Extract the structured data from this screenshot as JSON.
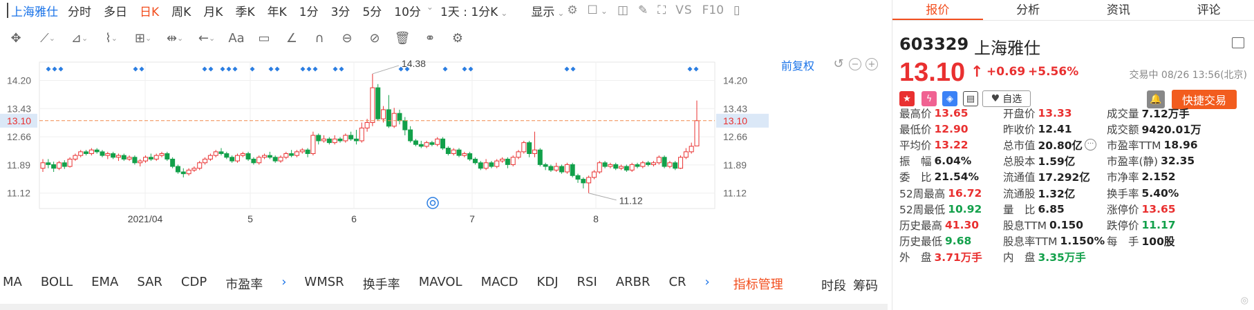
{
  "window": {
    "stock_name": "上海雅仕"
  },
  "period_tabs": [
    {
      "label": "分时",
      "active": false
    },
    {
      "label": "多日",
      "active": false
    },
    {
      "label": "日K",
      "active": true
    },
    {
      "label": "周K",
      "active": false
    },
    {
      "label": "月K",
      "active": false
    },
    {
      "label": "季K",
      "active": false
    },
    {
      "label": "年K",
      "active": false
    },
    {
      "label": "1分",
      "active": false
    },
    {
      "label": "3分",
      "active": false
    },
    {
      "label": "5分",
      "active": false
    },
    {
      "label": "10分",
      "active": false
    }
  ],
  "period_extra": {
    "interval_select": "1天 : 1分K",
    "display_menu": "显示",
    "vs_label": "VS",
    "f10_label": "F10"
  },
  "draw_tools": [
    "move-icon",
    "line-icon",
    "ray-icon",
    "wave-icon",
    "fib-icon",
    "range-icon",
    "arrow-icon",
    "text-icon",
    "comment-icon",
    "angle-icon",
    "arc-icon",
    "lock-icon",
    "hide-icon",
    "trash-icon",
    "overlay-icon",
    "settings-icon"
  ],
  "chart": {
    "fuquan_label": "前复权",
    "y_ticks": [
      "14.20",
      "13.43",
      "12.66",
      "11.89",
      "11.12"
    ],
    "current_price": "13.10",
    "high_label": "14.38",
    "low_label": "11.12",
    "x_ticks": [
      "2021/04",
      "5",
      "6",
      "7",
      "8"
    ]
  },
  "chart_data": {
    "type": "candlestick",
    "ylim": [
      10.7,
      14.7
    ],
    "current_price": 13.1,
    "high": 14.38,
    "low": 11.12,
    "candles": [
      [
        11.8,
        11.95,
        11.7,
        12.05
      ],
      [
        11.95,
        11.9,
        11.8,
        12.05
      ],
      [
        11.9,
        11.8,
        11.7,
        11.98
      ],
      [
        11.8,
        11.95,
        11.75,
        12.0
      ],
      [
        11.95,
        11.85,
        11.78,
        12.02
      ],
      [
        11.85,
        12.05,
        11.82,
        12.1
      ],
      [
        12.05,
        12.15,
        12.0,
        12.2
      ],
      [
        12.15,
        12.25,
        12.1,
        12.3
      ],
      [
        12.25,
        12.2,
        12.15,
        12.3
      ],
      [
        12.2,
        12.3,
        12.15,
        12.35
      ],
      [
        12.3,
        12.25,
        12.2,
        12.35
      ],
      [
        12.25,
        12.15,
        12.1,
        12.3
      ],
      [
        12.15,
        12.2,
        12.05,
        12.25
      ],
      [
        12.2,
        12.1,
        12.05,
        12.25
      ],
      [
        12.1,
        12.15,
        12.0,
        12.2
      ],
      [
        12.15,
        12.05,
        12.0,
        12.2
      ],
      [
        12.05,
        12.1,
        12.0,
        12.15
      ],
      [
        12.1,
        11.95,
        11.9,
        12.15
      ],
      [
        11.95,
        12.0,
        11.85,
        12.05
      ],
      [
        12.0,
        12.1,
        11.95,
        12.15
      ],
      [
        12.1,
        12.05,
        12.0,
        12.2
      ],
      [
        12.05,
        12.15,
        12.0,
        12.2
      ],
      [
        12.15,
        12.2,
        12.1,
        12.25
      ],
      [
        12.2,
        12.05,
        12.0,
        12.25
      ],
      [
        12.05,
        11.85,
        11.8,
        12.1
      ],
      [
        11.85,
        11.7,
        11.65,
        11.9
      ],
      [
        11.7,
        11.65,
        11.55,
        11.8
      ],
      [
        11.65,
        11.75,
        11.6,
        11.8
      ],
      [
        11.75,
        11.8,
        11.7,
        11.85
      ],
      [
        11.8,
        11.95,
        11.75,
        12.0
      ],
      [
        11.95,
        12.05,
        11.9,
        12.1
      ],
      [
        12.05,
        12.15,
        12.0,
        12.2
      ],
      [
        12.15,
        12.25,
        12.1,
        12.3
      ],
      [
        12.25,
        12.2,
        12.15,
        12.35
      ],
      [
        12.2,
        12.1,
        12.05,
        12.25
      ],
      [
        12.1,
        12.0,
        11.95,
        12.15
      ],
      [
        12.0,
        12.15,
        11.95,
        12.2
      ],
      [
        12.15,
        12.2,
        12.1,
        12.25
      ],
      [
        12.2,
        12.05,
        12.0,
        12.25
      ],
      [
        12.05,
        11.95,
        11.9,
        12.1
      ],
      [
        11.95,
        12.1,
        11.9,
        12.15
      ],
      [
        12.1,
        12.15,
        12.05,
        12.2
      ],
      [
        12.15,
        12.1,
        12.05,
        12.25
      ],
      [
        12.1,
        12.0,
        11.95,
        12.15
      ],
      [
        12.0,
        12.1,
        11.95,
        12.15
      ],
      [
        12.1,
        12.2,
        12.05,
        12.25
      ],
      [
        12.2,
        12.15,
        12.1,
        12.3
      ],
      [
        12.15,
        12.25,
        12.1,
        12.3
      ],
      [
        12.25,
        12.3,
        12.2,
        12.35
      ],
      [
        12.3,
        12.2,
        12.1,
        12.35
      ],
      [
        12.2,
        12.7,
        12.15,
        12.8
      ],
      [
        12.7,
        12.55,
        12.45,
        12.75
      ],
      [
        12.55,
        12.6,
        12.5,
        12.7
      ],
      [
        12.6,
        12.5,
        12.45,
        12.65
      ],
      [
        12.5,
        12.6,
        12.45,
        12.7
      ],
      [
        12.6,
        12.55,
        12.5,
        12.65
      ],
      [
        12.55,
        12.7,
        12.5,
        12.75
      ],
      [
        12.7,
        12.6,
        12.55,
        12.8
      ],
      [
        12.6,
        12.55,
        12.45,
        12.85
      ],
      [
        12.55,
        12.9,
        12.5,
        13.05
      ],
      [
        12.9,
        13.05,
        12.8,
        13.15
      ],
      [
        13.05,
        14.0,
        12.95,
        14.38
      ],
      [
        14.0,
        13.15,
        13.1,
        14.1
      ],
      [
        13.15,
        13.4,
        13.05,
        13.5
      ],
      [
        13.4,
        12.95,
        12.9,
        13.8
      ],
      [
        12.95,
        13.3,
        12.9,
        13.45
      ],
      [
        13.3,
        13.1,
        13.0,
        13.4
      ],
      [
        13.1,
        12.85,
        12.7,
        13.2
      ],
      [
        12.85,
        12.55,
        12.5,
        12.95
      ],
      [
        12.55,
        12.45,
        12.4,
        12.6
      ],
      [
        12.45,
        12.4,
        12.35,
        12.55
      ],
      [
        12.4,
        12.5,
        12.35,
        12.55
      ],
      [
        12.5,
        12.45,
        12.4,
        12.55
      ],
      [
        12.45,
        12.6,
        12.4,
        12.65
      ],
      [
        12.6,
        12.35,
        12.3,
        12.65
      ],
      [
        12.35,
        12.2,
        12.15,
        12.4
      ],
      [
        12.2,
        12.3,
        12.15,
        12.35
      ],
      [
        12.3,
        12.15,
        12.1,
        12.35
      ],
      [
        12.15,
        12.2,
        12.1,
        12.25
      ],
      [
        12.2,
        12.05,
        12.0,
        12.25
      ],
      [
        12.05,
        11.95,
        11.9,
        12.1
      ],
      [
        11.95,
        11.8,
        11.75,
        12.0
      ],
      [
        11.8,
        11.95,
        11.75,
        12.05
      ],
      [
        11.95,
        11.85,
        11.8,
        12.0
      ],
      [
        11.85,
        12.0,
        11.8,
        12.05
      ],
      [
        12.0,
        12.05,
        11.95,
        12.1
      ],
      [
        12.05,
        11.9,
        11.8,
        12.1
      ],
      [
        11.9,
        12.1,
        11.85,
        12.15
      ],
      [
        12.1,
        12.25,
        12.05,
        12.3
      ],
      [
        12.25,
        12.5,
        12.2,
        12.55
      ],
      [
        12.5,
        12.2,
        12.1,
        12.55
      ],
      [
        12.2,
        12.3,
        12.1,
        12.8
      ],
      [
        12.3,
        11.9,
        11.85,
        12.35
      ],
      [
        11.9,
        11.85,
        11.75,
        11.95
      ],
      [
        11.85,
        11.75,
        11.7,
        11.9
      ],
      [
        11.75,
        11.85,
        11.7,
        11.95
      ],
      [
        11.85,
        11.7,
        11.65,
        11.9
      ],
      [
        11.7,
        11.9,
        11.65,
        11.95
      ],
      [
        11.9,
        11.6,
        11.55,
        11.95
      ],
      [
        11.6,
        11.5,
        11.4,
        11.65
      ],
      [
        11.5,
        11.4,
        11.25,
        11.55
      ],
      [
        11.4,
        11.55,
        11.12,
        11.6
      ],
      [
        11.55,
        11.7,
        11.5,
        11.75
      ],
      [
        11.7,
        11.95,
        11.65,
        12.0
      ],
      [
        11.95,
        11.85,
        11.8,
        12.0
      ],
      [
        11.85,
        11.9,
        11.8,
        11.95
      ],
      [
        11.9,
        11.8,
        11.75,
        11.95
      ],
      [
        11.8,
        11.85,
        11.75,
        11.9
      ],
      [
        11.85,
        11.75,
        11.7,
        11.9
      ],
      [
        11.75,
        11.9,
        11.7,
        11.95
      ],
      [
        11.9,
        11.85,
        11.8,
        11.95
      ],
      [
        11.85,
        11.95,
        11.8,
        12.0
      ],
      [
        11.95,
        11.9,
        11.85,
        12.0
      ],
      [
        11.9,
        11.95,
        11.85,
        12.0
      ],
      [
        11.95,
        12.1,
        11.9,
        12.15
      ],
      [
        12.1,
        11.85,
        11.8,
        12.15
      ],
      [
        11.85,
        11.95,
        11.8,
        12.0
      ],
      [
        11.95,
        11.8,
        11.75,
        12.0
      ],
      [
        11.8,
        12.1,
        11.78,
        12.15
      ],
      [
        12.1,
        12.25,
        12.05,
        12.35
      ],
      [
        12.25,
        12.4,
        12.2,
        12.5
      ],
      [
        12.41,
        13.1,
        12.9,
        13.65
      ]
    ]
  },
  "marker_groups": [
    [
      70,
      3
    ],
    [
      196,
      2
    ],
    [
      296,
      2
    ],
    [
      322,
      3
    ],
    [
      365,
      1
    ],
    [
      392,
      2
    ],
    [
      438,
      3
    ],
    [
      485,
      2
    ],
    [
      580,
      2
    ],
    [
      644,
      1
    ],
    [
      672,
      2
    ],
    [
      820,
      2
    ],
    [
      998,
      2
    ]
  ],
  "x_tick_positions": [
    210,
    362,
    512,
    683,
    862
  ],
  "indicators": [
    "MA",
    "BOLL",
    "EMA",
    "SAR",
    "CDP",
    "市盈率",
    "›",
    "WMSR",
    "换手率",
    "MAVOL",
    "MACD",
    "KDJ",
    "RSI",
    "ARBR",
    "CR",
    "›"
  ],
  "indicator_manage": "指标管理",
  "indicator_right": [
    "时段",
    "筹码"
  ],
  "quote": {
    "tabs": [
      {
        "label": "报价",
        "active": true
      },
      {
        "label": "分析",
        "active": false
      },
      {
        "label": "资讯",
        "active": false
      },
      {
        "label": "评论",
        "active": false
      }
    ],
    "code": "603329",
    "name": "上海雅仕",
    "price": "13.10",
    "change": "+0.69",
    "change_pct": "+5.56%",
    "status": "交易中 08/26 13:56(北京)",
    "add_watch": "自选",
    "quick_trade": "快捷交易",
    "stats": [
      {
        "label": "最高价",
        "value": "13.65",
        "color": "red"
      },
      {
        "label": "开盘价",
        "value": "13.33",
        "color": "red"
      },
      {
        "label": "成交量",
        "value": "7.12万手",
        "color": "black"
      },
      {
        "label": "最低价",
        "value": "12.90",
        "color": "red"
      },
      {
        "label": "昨收价",
        "value": "12.41",
        "color": "black"
      },
      {
        "label": "成交额",
        "value": "9420.01万",
        "color": "black"
      },
      {
        "label": "平均价",
        "value": "13.22",
        "color": "red"
      },
      {
        "label": "总市值",
        "value": "20.80亿",
        "color": "black",
        "more": true
      },
      {
        "label": "市盈率TTM",
        "value": "18.96",
        "color": "black"
      },
      {
        "label": "振　幅",
        "value": "6.04%",
        "color": "black"
      },
      {
        "label": "总股本",
        "value": "1.59亿",
        "color": "black"
      },
      {
        "label": "市盈率(静)",
        "value": "32.35",
        "color": "black"
      },
      {
        "label": "委　比",
        "value": "21.54%",
        "color": "black"
      },
      {
        "label": "流通值",
        "value": "17.292亿",
        "color": "black"
      },
      {
        "label": "市净率",
        "value": "2.152",
        "color": "black"
      },
      {
        "label": "52周最高",
        "value": "16.72",
        "color": "red"
      },
      {
        "label": "流通股",
        "value": "1.32亿",
        "color": "black"
      },
      {
        "label": "换手率",
        "value": "5.40%",
        "color": "black"
      },
      {
        "label": "52周最低",
        "value": "10.92",
        "color": "green"
      },
      {
        "label": "量　比",
        "value": "6.85",
        "color": "black"
      },
      {
        "label": "涨停价",
        "value": "13.65",
        "color": "red"
      },
      {
        "label": "历史最高",
        "value": "41.30",
        "color": "red"
      },
      {
        "label": "股息TTM",
        "value": "0.150",
        "color": "black"
      },
      {
        "label": "跌停价",
        "value": "11.17",
        "color": "green"
      },
      {
        "label": "历史最低",
        "value": "9.68",
        "color": "green"
      },
      {
        "label": "股息率TTM",
        "value": "1.150%",
        "color": "black"
      },
      {
        "label": "每　手",
        "value": "100股",
        "color": "black"
      },
      {
        "label": "外　盘",
        "value": "3.71万手",
        "color": "red"
      },
      {
        "label": "内　盘",
        "value": "3.35万手",
        "color": "green"
      }
    ],
    "colors": {
      "up": "#e93030",
      "down": "#12a04a",
      "accent": "#f24e1e",
      "link": "#1a73e8"
    }
  }
}
